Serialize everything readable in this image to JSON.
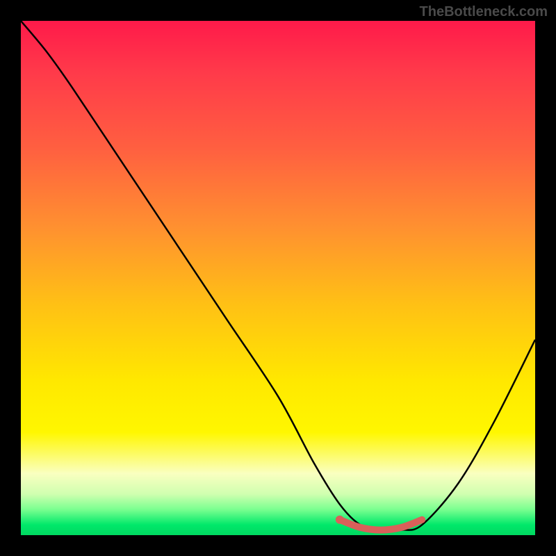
{
  "watermark": "TheBottleneck.com",
  "chart_data": {
    "type": "line",
    "title": "",
    "xlabel": "",
    "ylabel": "",
    "xlim": [
      0,
      100
    ],
    "ylim": [
      0,
      100
    ],
    "series": [
      {
        "name": "bottleneck-curve",
        "x": [
          0,
          5,
          10,
          20,
          30,
          40,
          50,
          57,
          62,
          66,
          70,
          74,
          78,
          85,
          92,
          100
        ],
        "y": [
          100,
          94,
          87,
          72,
          57,
          42,
          27,
          14,
          6,
          2,
          1,
          1,
          2,
          10,
          22,
          38
        ]
      },
      {
        "name": "optimal-range-marker",
        "x": [
          62,
          66,
          70,
          74,
          78
        ],
        "y": [
          3,
          1.5,
          1,
          1.5,
          3
        ]
      }
    ],
    "marker_color": "#d9605a",
    "curve_color": "#000000"
  }
}
